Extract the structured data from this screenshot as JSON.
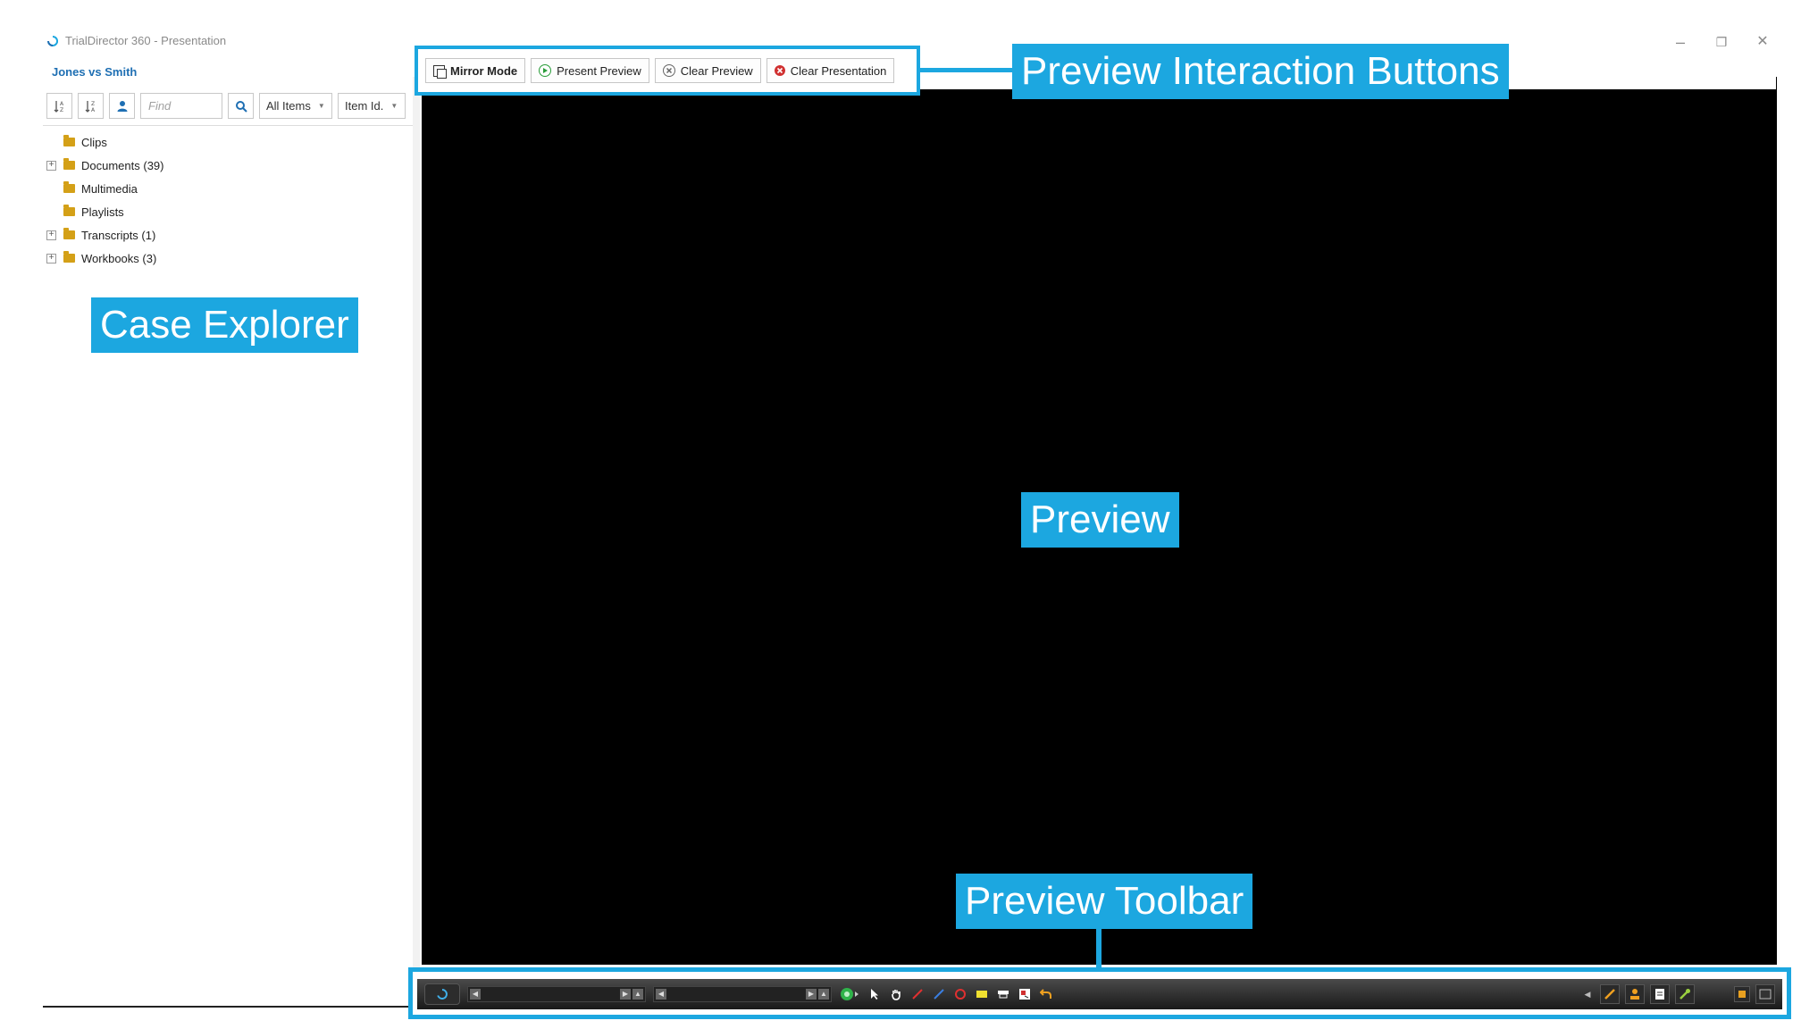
{
  "window": {
    "title": "TrialDirector 360 - Presentation",
    "controls": {
      "minimize": "–",
      "restore": "❐",
      "close": "✕"
    }
  },
  "case_explorer": {
    "case_name": "Jones vs Smith",
    "find_placeholder": "Find",
    "filter_select": "All Items",
    "sort_select": "Item Id.",
    "tree": [
      {
        "label": "Clips",
        "expandable": false
      },
      {
        "label": "Documents (39)",
        "expandable": true
      },
      {
        "label": "Multimedia",
        "expandable": false
      },
      {
        "label": "Playlists",
        "expandable": false
      },
      {
        "label": "Transcripts (1)",
        "expandable": true
      },
      {
        "label": "Workbooks (3)",
        "expandable": true
      }
    ]
  },
  "preview_buttons": {
    "mirror_mode": "Mirror Mode",
    "present_preview": "Present Preview",
    "clear_preview": "Clear Preview",
    "clear_presentation": "Clear Presentation"
  },
  "callouts": {
    "preview_interaction_buttons": "Preview Interaction Buttons",
    "case_explorer": "Case Explorer",
    "preview": "Preview",
    "preview_toolbar": "Preview Toolbar"
  },
  "colors": {
    "accent": "#1ca7e0",
    "case_name": "#1e6fb3",
    "folder": "#d4a017",
    "preview_bg": "#000000"
  },
  "toolbar_icons": [
    "select-arrow-icon",
    "hand-icon",
    "red-pen-icon",
    "blue-pen-icon",
    "ellipse-icon",
    "highlighter-icon",
    "redact-icon",
    "callout-icon",
    "undo-icon"
  ]
}
